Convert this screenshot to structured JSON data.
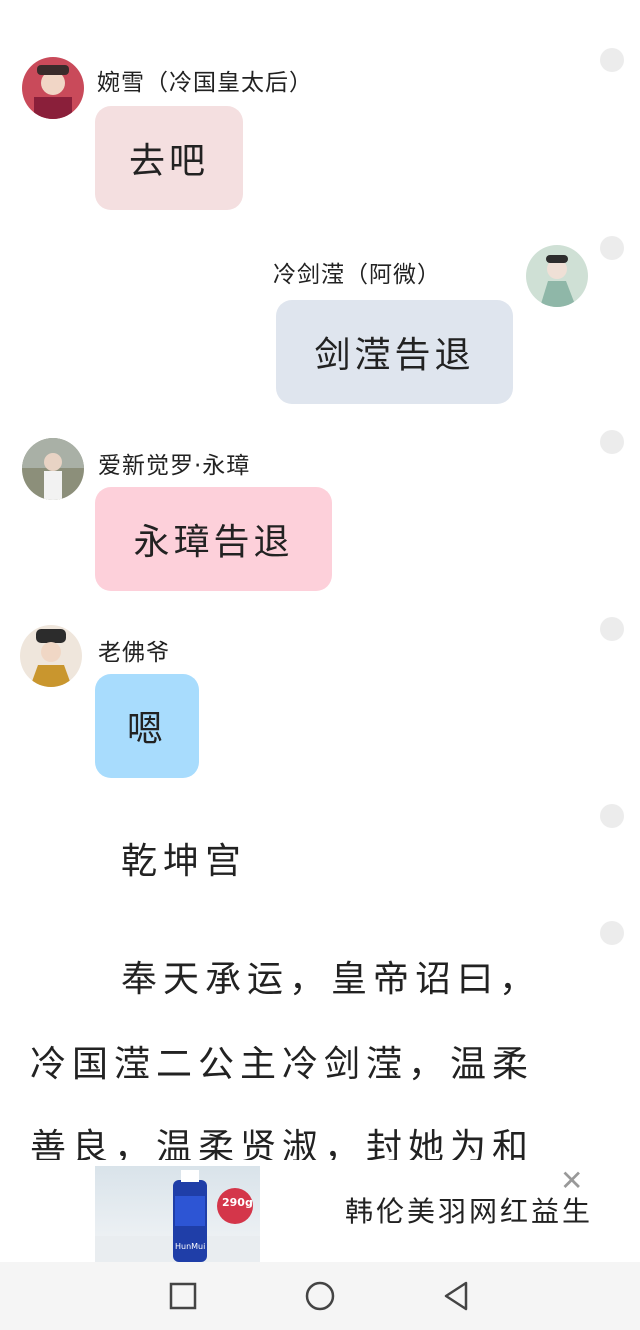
{
  "messages": [
    {
      "name": "婉雪（冷国皇太后）",
      "text": "去吧",
      "bubble_color": "#f4dfe0"
    },
    {
      "name": "冷剑滢（阿微）",
      "text": "剑滢告退",
      "bubble_color": "#dfe5ee"
    },
    {
      "name": "爱新觉罗·永璋",
      "text": "永璋告退",
      "bubble_color": "#fdd0da"
    },
    {
      "name": "老佛爷",
      "text": "嗯",
      "bubble_color": "#a8dcfd"
    }
  ],
  "story": {
    "heading": "乾坤宫",
    "lines": [
      "奉天承运，皇帝诏曰，",
      "冷国滢二公主冷剑滢，温柔",
      "善良，温柔贤淑，封她为和"
    ]
  },
  "ad": {
    "title": "韩伦美羽网红益生",
    "image_badge": "290g",
    "image_brand": "HunMui",
    "close_icon": "close-icon"
  },
  "navbar": {
    "icons": [
      "square-recent-icon",
      "circle-home-icon",
      "triangle-back-icon"
    ]
  }
}
